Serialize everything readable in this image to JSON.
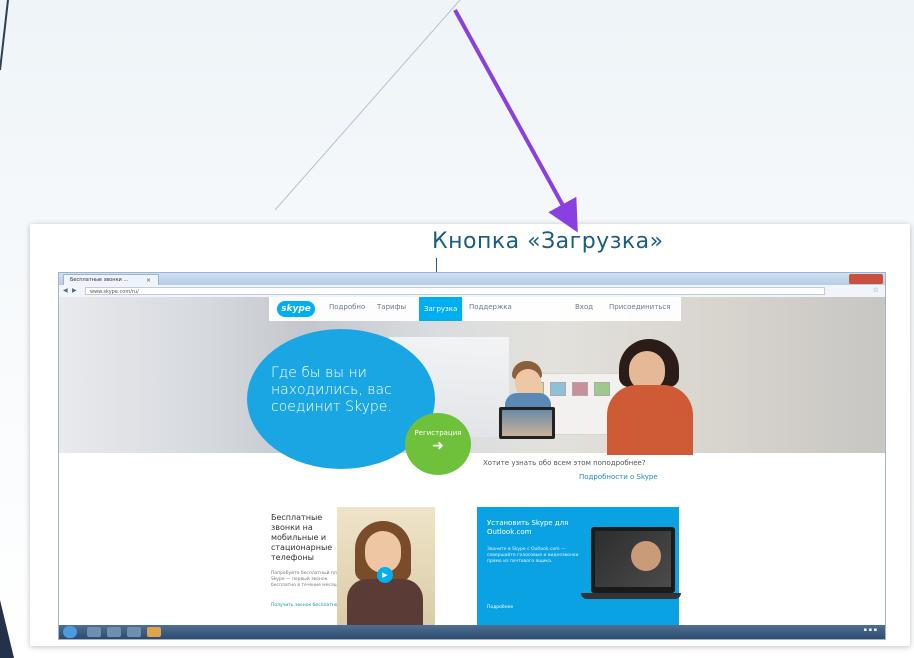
{
  "callout": {
    "label": "Кнопка «Загрузка»"
  },
  "browser": {
    "tab_title": "Бесплатные звонки …",
    "tab_close": "×",
    "url": "www.skype.com/ru/",
    "back_icon": "back-arrow-icon",
    "forward_icon": "forward-arrow-icon"
  },
  "site": {
    "logo": "skype",
    "nav": [
      {
        "label": "Подробно"
      },
      {
        "label": "Тарифы"
      },
      {
        "label": "Загрузка"
      },
      {
        "label": "Поддержка"
      }
    ],
    "nav_right": [
      {
        "label": "Вход"
      },
      {
        "label": "Присоединиться"
      }
    ],
    "hero_text": "Где бы вы ни находились, вас соединит Skype.",
    "register_button": "Регистрация",
    "register_arrow": "➜",
    "more_question": "Хотите узнать обо всем этом поподробнее?",
    "more_link": "Подробности о Skype"
  },
  "calls": {
    "title": "Бесплатные звонки на мобильные и стационарные телефоны",
    "desc": "Попробуйте бесплатный план Skype — первый звонок бесплатно в течение месяца.",
    "link": "Получить звонок бесплатно"
  },
  "outlook": {
    "title": "Установить Skype для Outlook.com",
    "desc": "Звоните в Skype с Outlook.com — совершайте голосовые и видеозвонки прямо из почтового ящика.",
    "link": "Подробнее"
  },
  "colors": {
    "skype_blue": "#00aff0",
    "register_green": "#6fc03b",
    "callout_text": "#1b5d80",
    "arrow_purple": "#8a3fe0"
  }
}
